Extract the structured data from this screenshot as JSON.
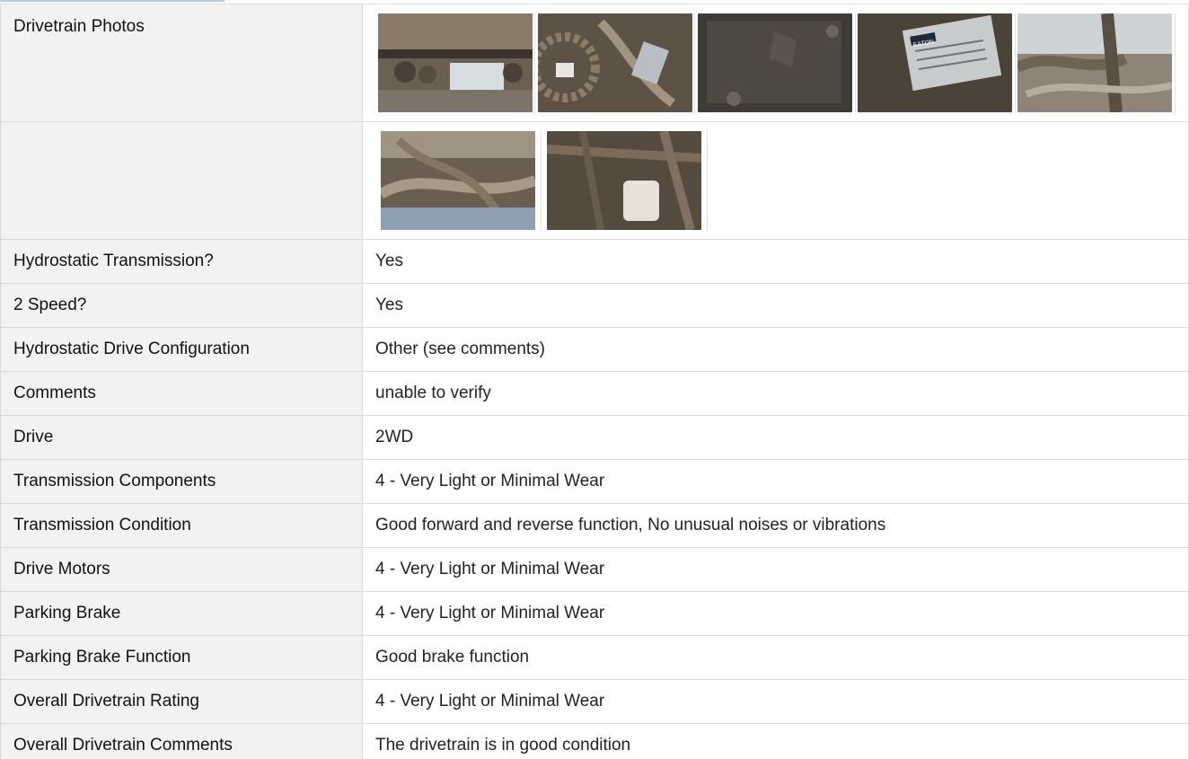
{
  "photos": {
    "label": "Drivetrain Photos",
    "rows": [
      [
        "undercarriage-photo",
        "hoses-pulley-photo",
        "casting-photo",
        "nameplate-photo",
        "frame-hoses-photo"
      ],
      [
        "hoses-cluster-photo",
        "filter-photo"
      ]
    ],
    "nameplate_brand": "EATON"
  },
  "rows": [
    {
      "label": "Hydrostatic Transmission?",
      "value": "Yes"
    },
    {
      "label": "2 Speed?",
      "value": "Yes"
    },
    {
      "label": "Hydrostatic Drive Configuration",
      "value": "Other (see comments)"
    },
    {
      "label": "Comments",
      "value": "unable to verify"
    },
    {
      "label": "Drive",
      "value": "2WD"
    },
    {
      "label": "Transmission Components",
      "value": "4 - Very Light or Minimal Wear"
    },
    {
      "label": "Transmission Condition",
      "value": "Good forward and reverse function, No unusual noises or vibrations"
    },
    {
      "label": "Drive Motors",
      "value": "4 - Very Light or Minimal Wear"
    },
    {
      "label": "Parking Brake",
      "value": "4 - Very Light or Minimal Wear"
    },
    {
      "label": "Parking Brake Function",
      "value": "Good brake function"
    },
    {
      "label": "Overall Drivetrain Rating",
      "value": "4 - Very Light or Minimal Wear"
    },
    {
      "label": "Overall Drivetrain Comments",
      "value": "The drivetrain is in good condition"
    }
  ]
}
